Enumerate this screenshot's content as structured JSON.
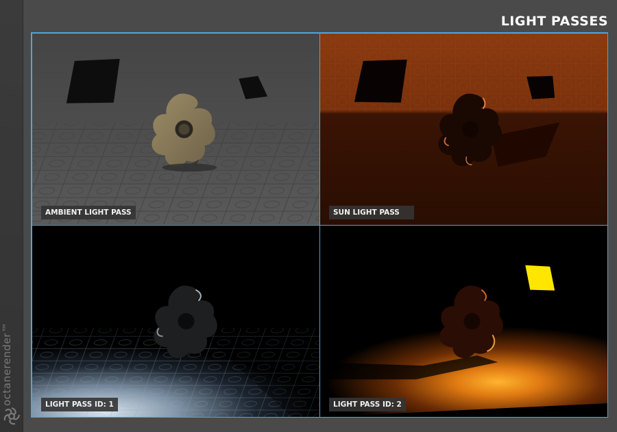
{
  "header": {
    "title": "LIGHT PASSES"
  },
  "brand": {
    "name": "octanerender™"
  },
  "panels": [
    {
      "label": "AMBIENT LIGHT PASS"
    },
    {
      "label": "SUN LIGHT PASS"
    },
    {
      "label": "LIGHT PASS ID: 1"
    },
    {
      "label": "LIGHT PASS ID: 2"
    }
  ],
  "colors": {
    "border": "#4aa8e0",
    "background": "#4a4a4a",
    "sidebar": "#363636"
  }
}
